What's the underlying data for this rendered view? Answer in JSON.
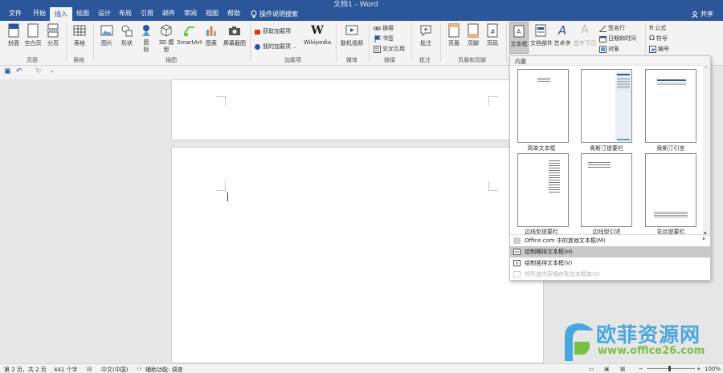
{
  "window": {
    "title": "文档1 - Word",
    "share_label": "共享"
  },
  "tabs": [
    {
      "label": "文件"
    },
    {
      "label": "开始"
    },
    {
      "label": "插入"
    },
    {
      "label": "绘图"
    },
    {
      "label": "设计"
    },
    {
      "label": "布局"
    },
    {
      "label": "引用"
    },
    {
      "label": "邮件"
    },
    {
      "label": "审阅"
    },
    {
      "label": "视图"
    },
    {
      "label": "帮助"
    }
  ],
  "search": {
    "label": "操作说明搜索"
  },
  "ribbon": {
    "pages": {
      "cover": "封面",
      "blank": "空白页",
      "break": "分页",
      "group": "页面"
    },
    "tables": {
      "table": "表格",
      "group": "表格"
    },
    "illustrations": {
      "picture": "图片",
      "shapes": "形状",
      "icons": "图标",
      "model3d": "3D 模型",
      "smartart": "SmartArt",
      "chart": "图表",
      "screenshot": "屏幕截图",
      "group": "插图"
    },
    "addins": {
      "get": "获取加载项",
      "mine": "我的加载项",
      "wikipedia": "Wikipedia",
      "group": "加载项"
    },
    "media": {
      "video": "联机视频",
      "group": "媒体"
    },
    "links": {
      "link": "链接",
      "bookmark": "书签",
      "crossref": "交叉引用",
      "group": "链接"
    },
    "comments": {
      "comment": "批注",
      "group": "批注"
    },
    "headerfooter": {
      "header": "页眉",
      "footer": "页脚",
      "pagenum": "页码",
      "group": "页眉和页脚"
    },
    "text": {
      "textbox": "文本框",
      "quickparts": "文档部件",
      "wordart": "艺术字",
      "dropcap": "首字下沉",
      "signature": "签名行",
      "datetime": "日期和时间",
      "object": "对象"
    },
    "symbols": {
      "equation": "公式",
      "symbol": "符号",
      "number": "编号"
    }
  },
  "dropdown": {
    "section": "内置",
    "thumbs": [
      {
        "caption": "简单文本框"
      },
      {
        "caption": "奥斯汀提要栏"
      },
      {
        "caption": "奥斯汀引言"
      },
      {
        "caption": "边线型提要栏"
      },
      {
        "caption": "边线型引述"
      },
      {
        "caption": "花丝提要栏"
      }
    ],
    "menu": [
      {
        "label": "Office.com 中的其他文本框(M)"
      },
      {
        "label": "绘制横排文本框(H)"
      },
      {
        "label": "绘制竖排文本框(V)"
      },
      {
        "label": "将所选内容保存到文本框库(S)"
      }
    ]
  },
  "statusbar": {
    "pages": "第 2 页，共 2 页",
    "words": "441 个字",
    "language": "中文(中国)",
    "accessibility": "辅助功能: 调查",
    "zoom": "100%"
  },
  "watermark": {
    "title": "欧菲资源网",
    "url": "www.office26.com"
  },
  "colors": {
    "accent": "#2b579a",
    "highlight": "#c8c8c8",
    "watermark_blue": "#4aa7de",
    "watermark_green": "#7ac143"
  }
}
